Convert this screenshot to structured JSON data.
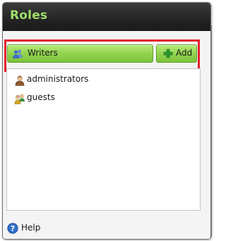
{
  "panel": {
    "title": "Roles"
  },
  "role_selector": {
    "selected": "Writers",
    "icon": "users-icon"
  },
  "add_button": {
    "label": "Add",
    "icon": "plus-icon"
  },
  "roles_list": {
    "items": [
      {
        "label": "administrators",
        "icon": "admin-user-icon"
      },
      {
        "label": "guests",
        "icon": "group-icon"
      }
    ]
  },
  "help": {
    "label": "Help",
    "icon": "help-icon"
  },
  "colors": {
    "title_text": "#9ee06a",
    "title_bar": "#232323",
    "button_green": "#8fd14c",
    "highlight_red": "#e0202a"
  }
}
